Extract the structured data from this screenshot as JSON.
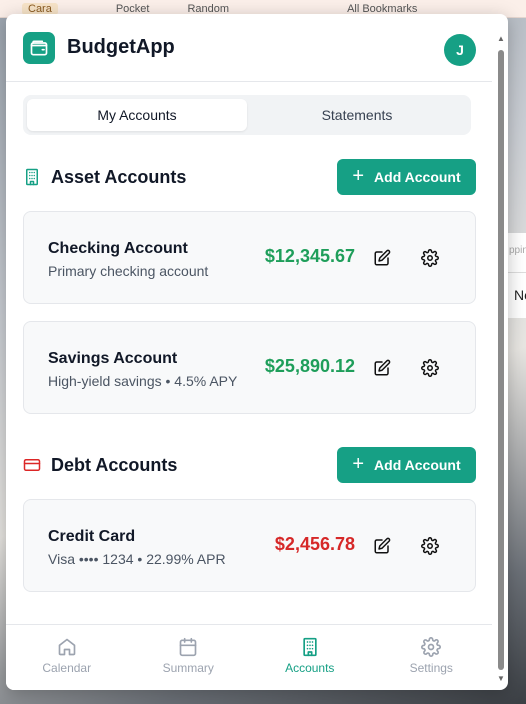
{
  "browser": {
    "items": [
      "Cara",
      "Pocket",
      "Random",
      "All Bookmarks"
    ]
  },
  "side_panel": {
    "top": "pping",
    "bottom": "Ne"
  },
  "app": {
    "title": "BudgetApp",
    "avatar_initial": "J",
    "accent": "#16a085"
  },
  "tabs": [
    {
      "label": "My Accounts",
      "active": true
    },
    {
      "label": "Statements",
      "active": false
    }
  ],
  "asset_section": {
    "title": "Asset Accounts",
    "add_label": "Add Account",
    "accounts": [
      {
        "name": "Checking Account",
        "desc": "Primary checking account",
        "amount": "$12,345.67"
      },
      {
        "name": "Savings Account",
        "desc": "High-yield savings • 4.5% APY",
        "amount": "$25,890.12"
      }
    ]
  },
  "debt_section": {
    "title": "Debt Accounts",
    "add_label": "Add Account",
    "accounts": [
      {
        "name": "Credit Card",
        "desc": "Visa •••• 1234 • 22.99% APR",
        "amount": "$2,456.78"
      }
    ]
  },
  "nav": [
    {
      "label": "Calendar",
      "icon": "home-icon",
      "active": false
    },
    {
      "label": "Summary",
      "icon": "calendar-icon",
      "active": false
    },
    {
      "label": "Accounts",
      "icon": "building-icon",
      "active": true
    },
    {
      "label": "Settings",
      "icon": "gear-icon",
      "active": false
    }
  ],
  "colors": {
    "positive": "#1e9e5a",
    "negative": "#d62828",
    "debt_icon": "#dc2626"
  }
}
